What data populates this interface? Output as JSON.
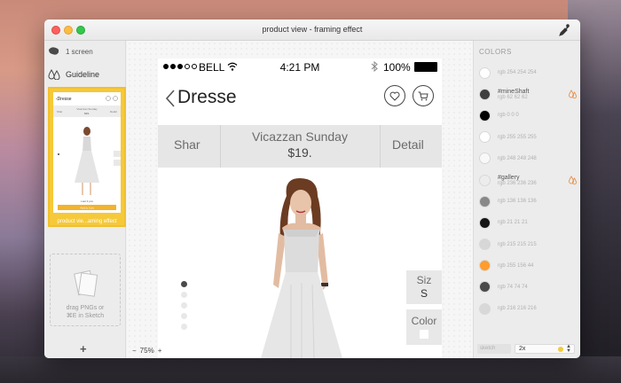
{
  "window": {
    "title": "product view - framing effect"
  },
  "sidebar": {
    "screens_label": "1 screen",
    "guideline_label": "Guideline",
    "thumbnail_caption": "product vie...aming effect",
    "drop_zone_text": "drag PNGs or\n⌘E in Sketch",
    "add_label": "+"
  },
  "canvas": {
    "zoom_minus": "−",
    "zoom_level": "75%",
    "zoom_plus": "+"
  },
  "phone": {
    "status": {
      "carrier": "BELL",
      "time": "4:21 PM",
      "battery": "100%"
    },
    "nav": {
      "title": "Dresse"
    },
    "product_bar": {
      "share": "Shar",
      "name": "Vicazzan Sunday",
      "price": "$19.",
      "detail": "Detail"
    },
    "size_tab": {
      "label": "Siz",
      "value": "S"
    },
    "color_tab": {
      "label": "Color"
    },
    "pager": {
      "count": 5,
      "active": 0
    }
  },
  "colors_panel": {
    "header": "COLORS",
    "items": [
      {
        "name": "",
        "rgb": "rgb 254 254 254",
        "hex": "#fefefe",
        "drop": false
      },
      {
        "name": "#mineShaft",
        "rgb": "rgb 62 62 62",
        "hex": "#3e3e3e",
        "drop": true
      },
      {
        "name": "",
        "rgb": "rgb 0 0 0",
        "hex": "#000000",
        "drop": false
      },
      {
        "name": "",
        "rgb": "rgb 255 255 255",
        "hex": "#ffffff",
        "drop": false
      },
      {
        "name": "",
        "rgb": "rgb 248 248 248",
        "hex": "#f8f8f8",
        "drop": false
      },
      {
        "name": "#gallery",
        "rgb": "rgb 236 236 236",
        "hex": "#ececec",
        "drop": true
      },
      {
        "name": "",
        "rgb": "rgb 136 136 136",
        "hex": "#888888",
        "drop": false
      },
      {
        "name": "",
        "rgb": "rgb 21 21 21",
        "hex": "#151515",
        "drop": false
      },
      {
        "name": "",
        "rgb": "rgb 215 215 215",
        "hex": "#d7d7d7",
        "drop": false
      },
      {
        "name": "",
        "rgb": "rgb 255 156 44",
        "hex": "#ff9c2c",
        "drop": false
      },
      {
        "name": "",
        "rgb": "rgb 74 74 74",
        "hex": "#4a4a4a",
        "drop": false
      },
      {
        "name": "",
        "rgb": "rgb 216 216 216",
        "hex": "#d8d8d8",
        "drop": false
      }
    ],
    "sketch_placeholder": "sketch",
    "scale_value": "2x"
  },
  "colors": {
    "accent": "#f5c93a",
    "drop_icon": "#e8914a"
  }
}
